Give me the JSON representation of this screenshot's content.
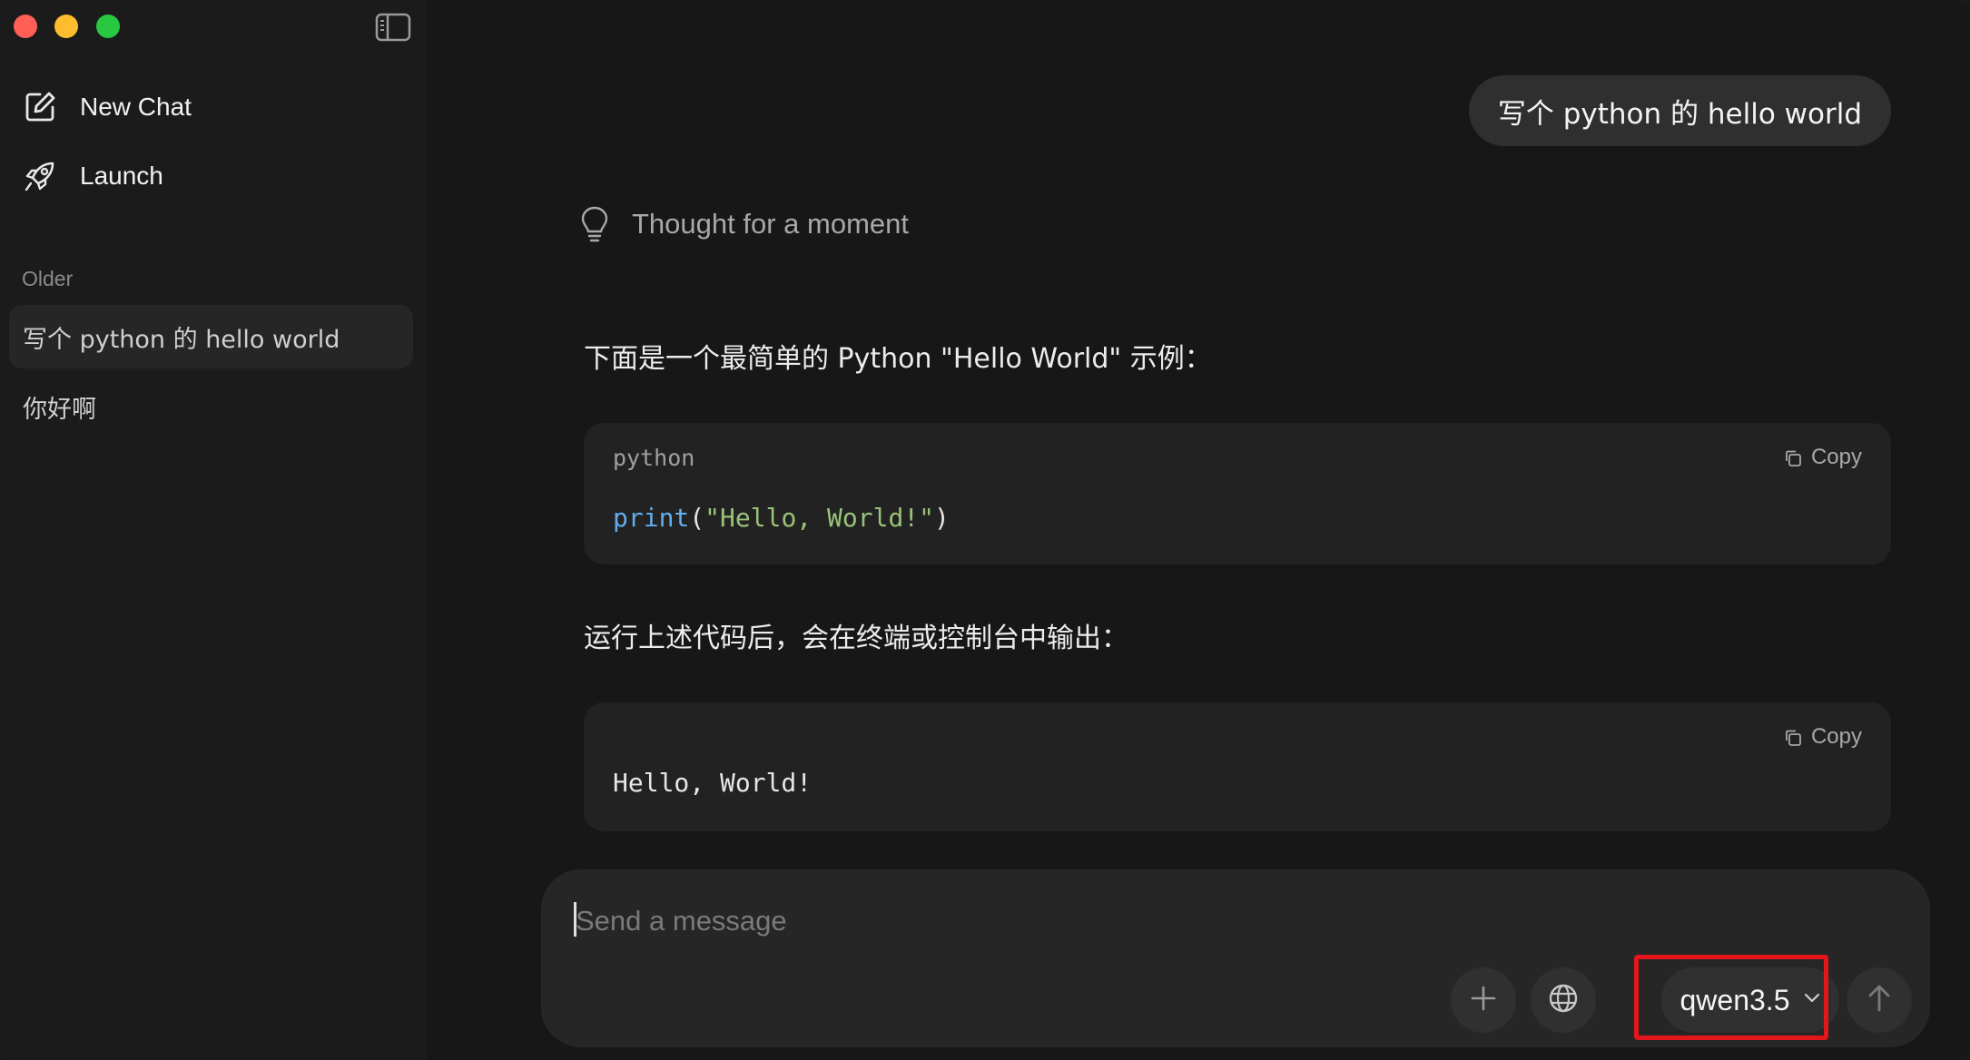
{
  "sidebar": {
    "items": [
      {
        "label": "New Chat",
        "icon": "compose-icon"
      },
      {
        "label": "Launch",
        "icon": "rocket-icon"
      }
    ],
    "section_label": "Older",
    "chats": [
      {
        "label": "写个 python 的 hello world",
        "active": true
      },
      {
        "label": "你好啊",
        "active": false
      }
    ]
  },
  "conversation": {
    "user_message": "写个 python 的 hello world",
    "thought_label": "Thought for a moment",
    "intro_text": "下面是一个最简单的 Python \"Hello World\" 示例：",
    "code_block_1": {
      "language": "python",
      "copy_label": "Copy",
      "code": {
        "func": "print",
        "open": "(",
        "string": "\"Hello, World!\"",
        "close": ")"
      }
    },
    "after_text": "运行上述代码后，会在终端或控制台中输出：",
    "code_block_2": {
      "copy_label": "Copy",
      "output": "Hello, World!"
    }
  },
  "composer": {
    "placeholder": "Send a message",
    "model": "qwen3.5"
  },
  "colors": {
    "accent_highlight": "#e5161b",
    "code_keyword": "#61aeee",
    "code_string": "#98c379"
  }
}
